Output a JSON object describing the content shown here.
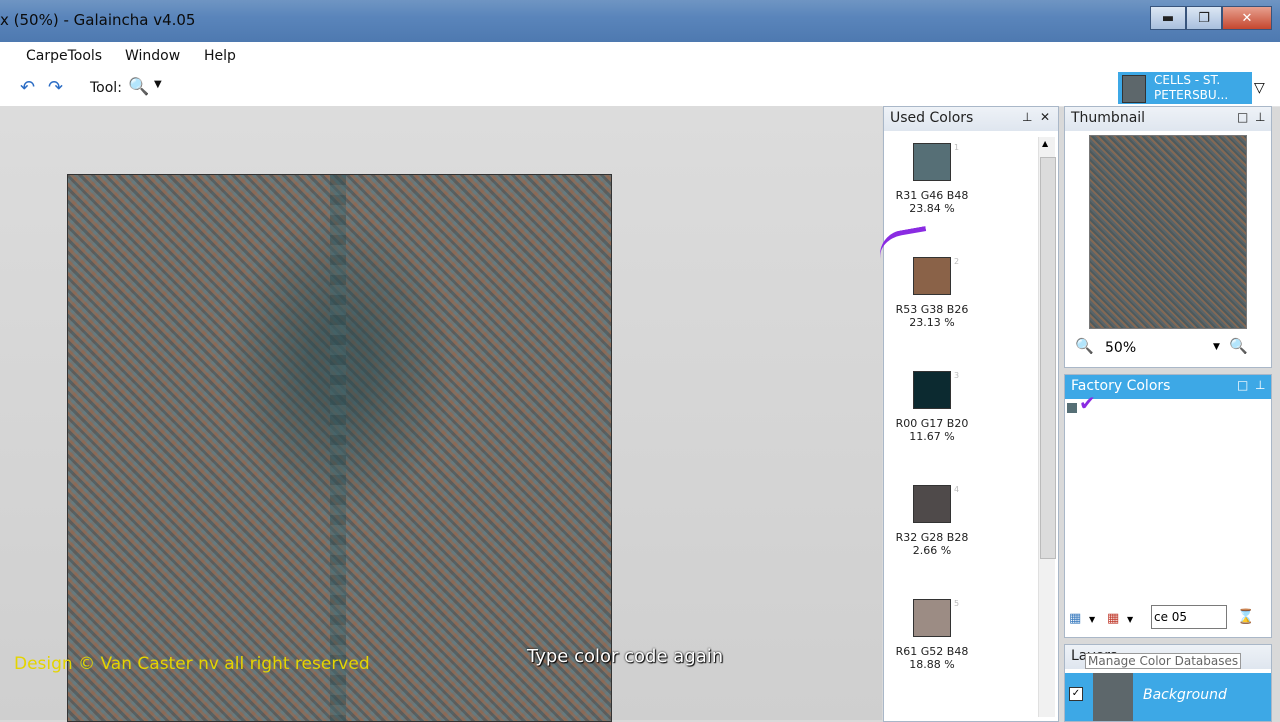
{
  "window": {
    "title": "x (50%) - Galaincha v4.05",
    "minimize": "▬",
    "maximize": "❐",
    "close": "✕"
  },
  "menu": [
    "CarpeTools",
    "Window",
    "Help"
  ],
  "toolbar": {
    "tool_label": "Tool:"
  },
  "design_tag": {
    "line1": "CELLS - ST.",
    "line2": "PETERSBU..."
  },
  "used_colors": {
    "title": "Used Colors",
    "items": [
      {
        "index": "1",
        "rgb": "R31 G46 B48",
        "percent": "23.84 %",
        "color": "#566f76"
      },
      {
        "index": "2",
        "rgb": "R53 G38 B26",
        "percent": "23.13 %",
        "color": "#8a6248"
      },
      {
        "index": "3",
        "rgb": "R00 G17 B20",
        "percent": "11.67 %",
        "color": "#0c2a30"
      },
      {
        "index": "4",
        "rgb": "R32 G28 B28",
        "percent": "2.66 %",
        "color": "#4f4a4a"
      },
      {
        "index": "5",
        "rgb": "R61 G52 B48",
        "percent": "18.88 %",
        "color": "#9c8c84"
      }
    ]
  },
  "thumbnail": {
    "title": "Thumbnail",
    "zoom": "50%"
  },
  "factory_colors": {
    "title": "Factory Colors",
    "search_value": "ce 05"
  },
  "layers": {
    "title": "Layers",
    "tooltip": "Manage Color Databases",
    "row_label": "Background"
  },
  "overlay": {
    "watermark": "Design © Van Caster nv all right reserved",
    "caption": "Type color code again"
  }
}
